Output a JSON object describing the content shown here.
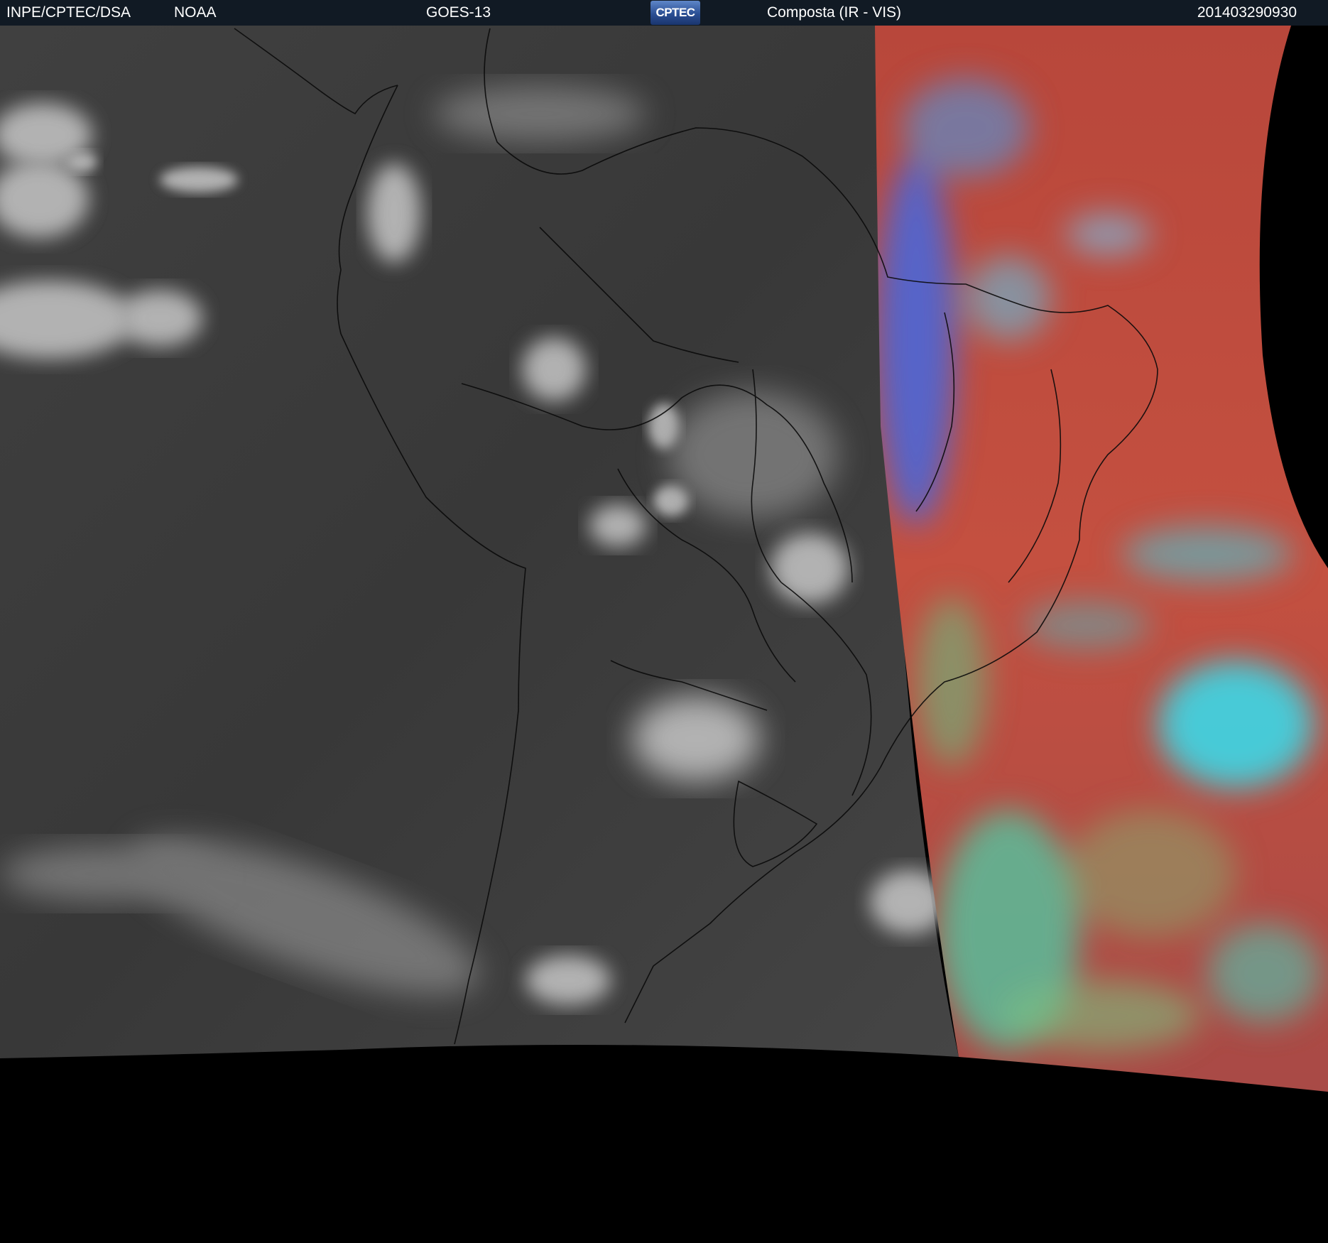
{
  "header": {
    "organization": "INPE/CPTEC/DSA",
    "agency": "NOAA",
    "satellite": "GOES-13",
    "logo_text": "CPTEC",
    "product": "Composta (IR - VIS)",
    "timestamp": "201403290930"
  },
  "colors": {
    "background": "#000000",
    "header_background": "#111a24",
    "ir_earth": "#3a3a3a",
    "vis_land_surface": "#b5483c",
    "vis_low_cloud": "#54c4a0",
    "vis_high_cloud": "#3ad8e8",
    "vis_terminator_blue": "#4a66d8"
  }
}
